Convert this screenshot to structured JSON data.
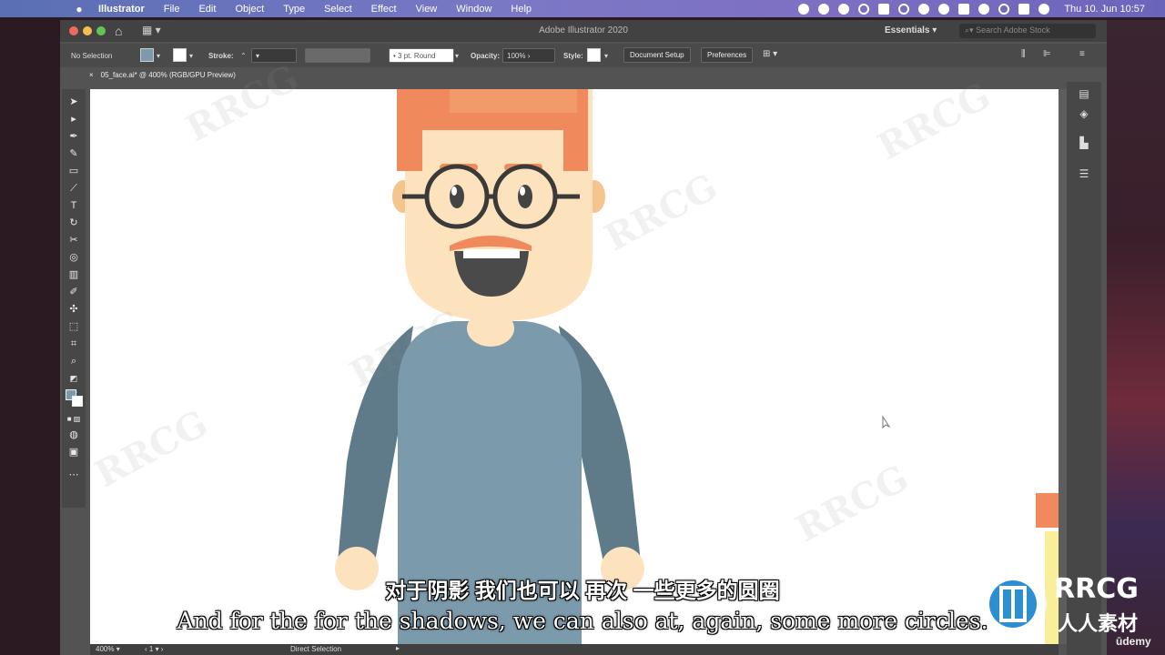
{
  "menubar": {
    "app": "Illustrator",
    "items": [
      "File",
      "Edit",
      "Object",
      "Type",
      "Select",
      "Effect",
      "View",
      "Window",
      "Help"
    ],
    "datetime": "Thu 10. Jun  10:57"
  },
  "window": {
    "title": "Adobe Illustrator 2020",
    "workspace": "Essentials",
    "search_placeholder": "Search Adobe Stock"
  },
  "control": {
    "selection": "No Selection",
    "stroke_label": "Stroke:",
    "brush": "3 pt. Round",
    "opacity_label": "Opacity:",
    "opacity_value": "100%",
    "style_label": "Style:",
    "document_setup": "Document Setup",
    "preferences": "Preferences"
  },
  "document": {
    "tab": "05_face.ai* @ 400% (RGB/GPU Preview)"
  },
  "status": {
    "zoom": "400%",
    "artboard": "1",
    "tool": "Direct Selection"
  },
  "subtitles": {
    "cn": "对于阴影 我们也可以 再次 一些更多的圆圈",
    "en": "And for the for the shadows, we can also at, again, some more circles."
  },
  "logo": {
    "brand": "RRCG",
    "brand_cn": "人人素材",
    "udemy": "ūdemy"
  },
  "colors": {
    "hair": "#f08a5d",
    "skin": "#fde3bd",
    "shirt": "#7b9aac",
    "sleeve": "#5f7a89",
    "glasses": "#3a3a3a"
  }
}
